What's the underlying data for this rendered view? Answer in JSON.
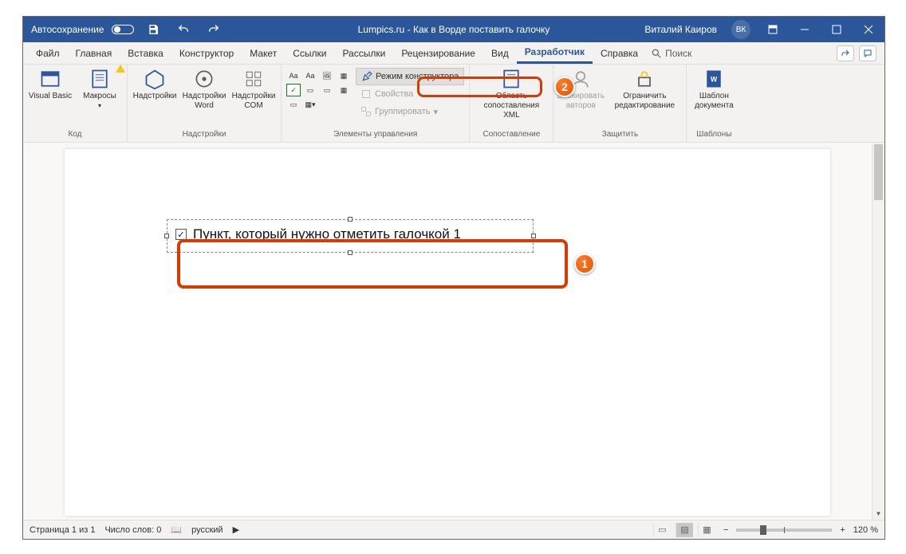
{
  "titlebar": {
    "autosave": "Автосохранение",
    "doc_title": "Lumpics.ru - Как в Ворде поставить галочку",
    "user": "Виталий Каиров",
    "initials": "ВК"
  },
  "tabs": {
    "items": [
      "Файл",
      "Главная",
      "Вставка",
      "Конструктор",
      "Макет",
      "Ссылки",
      "Рассылки",
      "Рецензирование",
      "Вид",
      "Разработчик",
      "Справка"
    ],
    "active_index": 9,
    "search_label": "Поиск"
  },
  "ribbon": {
    "code": {
      "label": "Код",
      "vb": "Visual Basic",
      "macros": "Макросы"
    },
    "addins": {
      "label": "Надстройки",
      "addins_btn": "Надстройки",
      "word": "Надстройки Word",
      "com": "Надстройки COM"
    },
    "controls": {
      "label": "Элементы управления",
      "design_mode": "Режим конструктора",
      "properties": "Свойства",
      "group": "Группировать"
    },
    "mapping": {
      "label": "Сопоставление",
      "xml": "Область сопоставления XML"
    },
    "protect": {
      "label": "Защитить",
      "block": "Блокировать авторов",
      "restrict": "Ограничить редактирование"
    },
    "templates": {
      "label": "Шаблоны",
      "template": "Шаблон документа"
    }
  },
  "document": {
    "text": "Пункт, который нужно отметить галочкой 1"
  },
  "status": {
    "page": "Страница 1 из 1",
    "words": "Число слов: 0",
    "lang": "русский",
    "zoom": "120 %"
  },
  "annotations": {
    "badge1": "1",
    "badge2": "2"
  }
}
